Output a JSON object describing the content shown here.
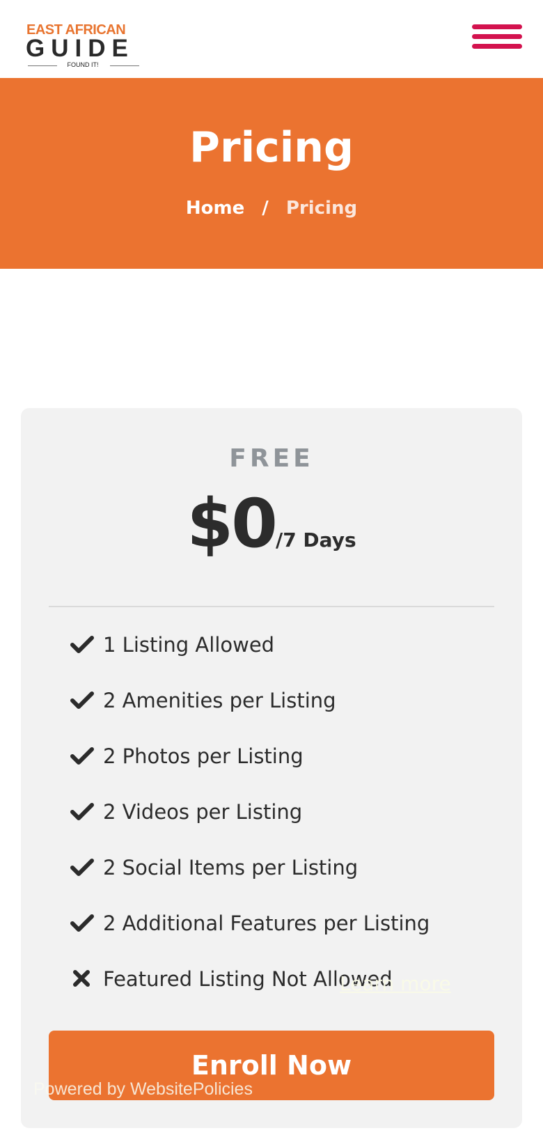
{
  "header": {
    "logo": {
      "line1": "EAST AFRICAN",
      "line2": "GUIDE",
      "tagline": "FOUND IT!"
    },
    "menu_icon": "hamburger-icon",
    "menu_color": "#d3124e"
  },
  "hero": {
    "title": "Pricing",
    "breadcrumb": {
      "home": "Home",
      "separator": "/",
      "current": "Pricing"
    },
    "background": "#eb7330"
  },
  "plan": {
    "name": "FREE",
    "price": "$0",
    "period": "/7 Days",
    "features": [
      {
        "icon": "check-icon",
        "label": "1 Listing Allowed"
      },
      {
        "icon": "check-icon",
        "label": "2 Amenities per Listing"
      },
      {
        "icon": "check-icon",
        "label": "2 Photos per Listing"
      },
      {
        "icon": "check-icon",
        "label": "2 Videos per Listing"
      },
      {
        "icon": "check-icon",
        "label": "2 Social Items per Listing"
      },
      {
        "icon": "check-icon",
        "label": "2 Additional Features per Listing"
      },
      {
        "icon": "cross-icon",
        "label": "Featured Listing Not Allowed"
      }
    ],
    "button_label": "Enroll Now"
  },
  "overlay": {
    "learn_more": "Learn more",
    "powered_by": "Powered by WebsitePolicies"
  }
}
